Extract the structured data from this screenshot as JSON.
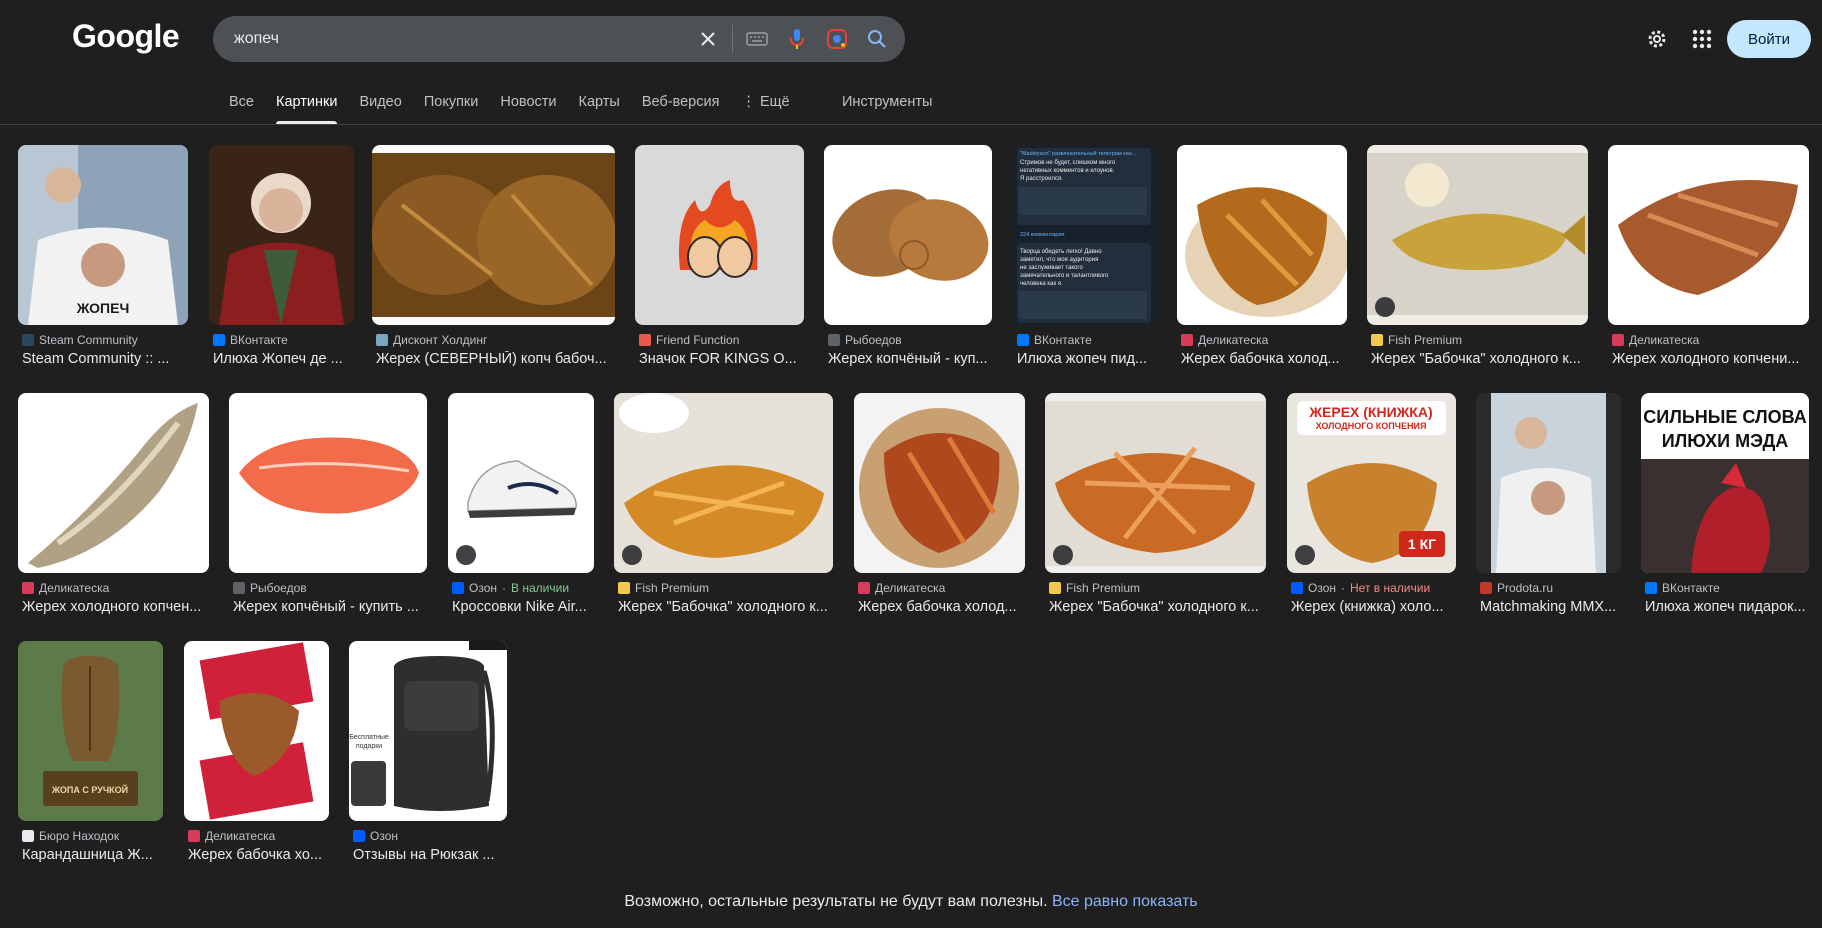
{
  "logo": "Google",
  "search": {
    "query": "жопеч"
  },
  "header": {
    "signin_label": "Войти"
  },
  "tabs": [
    "Все",
    "Картинки",
    "Видео",
    "Покупки",
    "Новости",
    "Карты",
    "Веб-версия",
    "⋮ Ещё"
  ],
  "tools_label": "Инструменты",
  "results": [
    {
      "source": "Steam Community",
      "title": "Steam Community :: ...",
      "fav": "#2a475e"
    },
    {
      "source": "ВКонтакте",
      "title": "Илюха Жопеч де ...",
      "fav": "#0077ff"
    },
    {
      "source": "Дисконт Холдинг",
      "title": "Жерех (СЕВЕРНЫЙ) копч бабоч...",
      "fav": "#7aa6c2"
    },
    {
      "source": "Friend Function",
      "title": "Значок FOR KINGS O...",
      "fav": "#e8594c"
    },
    {
      "source": "Рыбоедов",
      "title": "Жерех копчёный - куп...",
      "fav": "#5f6368"
    },
    {
      "source": "ВКонтакте",
      "title": "Илюха жопеч пид...",
      "fav": "#0077ff"
    },
    {
      "source": "Деликатеска",
      "title": "Жерех бабочка холод...",
      "fav": "#d93b5a"
    },
    {
      "source": "Fish Premium",
      "title": "Жерех \"Бабочка\" холодного к...",
      "fav": "#f2c94c"
    },
    {
      "source": "Деликатеска",
      "title": "Жерех холодного копчени...",
      "fav": "#d93b5a"
    },
    {
      "source": "Деликатеска",
      "title": "Жерех холодного копчен...",
      "fav": "#d93b5a"
    },
    {
      "source": "Рыбоедов",
      "title": "Жерех копчёный - купить ...",
      "fav": "#5f6368"
    },
    {
      "source": "Озон",
      "stock": "В наличии",
      "title": "Кроссовки Nike Air...",
      "fav": "#005bff"
    },
    {
      "source": "Fish Premium",
      "title": "Жерех \"Бабочка\" холодного к...",
      "fav": "#f2c94c"
    },
    {
      "source": "Деликатеска",
      "title": "Жерех бабочка холод...",
      "fav": "#d93b5a"
    },
    {
      "source": "Fish Premium",
      "title": "Жерех \"Бабочка\" холодного к...",
      "fav": "#f2c94c"
    },
    {
      "source": "Озон",
      "stock": "Нет в наличии",
      "title": "Жерех (книжка) холо...",
      "fav": "#005bff"
    },
    {
      "source": "Prodota.ru",
      "title": "Matchmaking MMX...",
      "fav": "#c0392b"
    },
    {
      "source": "ВКонтакте",
      "title": "Илюха жопеч пидарок...",
      "fav": "#0077ff"
    },
    {
      "source": "Бюро Находок",
      "title": "Карандашница Ж...",
      "fav": "#e8eaed"
    },
    {
      "source": "Деликатеска",
      "title": "Жерех бабочка хо...",
      "fav": "#d93b5a"
    },
    {
      "source": "Озон",
      "title": "Отзывы на Рюкзак ...",
      "fav": "#005bff"
    }
  ],
  "image_text": {
    "shirt": "ЖОПЕЧ",
    "chat": [
      "\"Madstyson\" развлекательный телеграм кан...",
      "Стримов не будет, слишком много",
      "негативных комментов и клоунов.",
      "Я расстроился.",
      "224 комментария",
      "Творца обидеть легко! Давно",
      "заметил, что моя аудитория",
      "не заслуживает такого",
      "замечательного и талантливого",
      "человека как я."
    ],
    "book_banner": [
      "ЖЕРЕХ (КНИЖКА)",
      "ХОЛОДНОГО КОПЧЕНИЯ"
    ],
    "weight": "1 КГ",
    "words": [
      "СИЛЬНЫЕ СЛОВА",
      "ИЛЮХИ МЭДА"
    ],
    "stand": "ЖОПА С РУЧКОЙ",
    "gift": [
      "Бесплатные",
      "подарки"
    ]
  },
  "footer": {
    "text": "Возможно, остальные результаты не будут вам полезны.",
    "link": "Все равно показать"
  }
}
